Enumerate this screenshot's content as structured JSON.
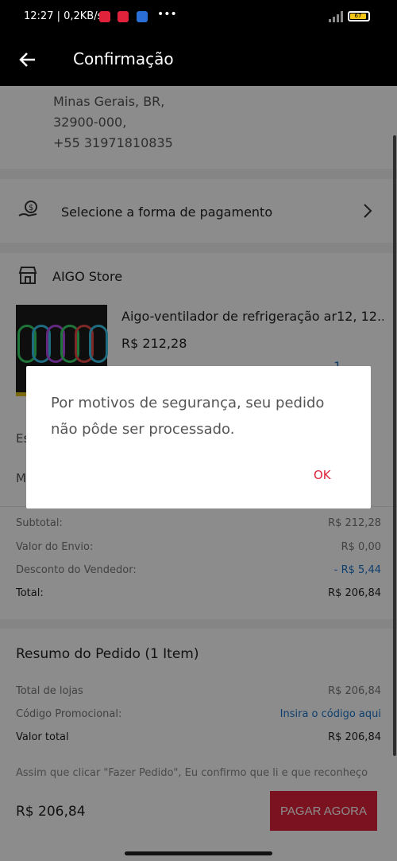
{
  "status": {
    "time": "12:27 | 0,2KB/s",
    "battery": "67",
    "network": "4G"
  },
  "appbar": {
    "title": "Confirmação"
  },
  "address": {
    "lines": [
      "Minas Gerais, BR,",
      "32900-000,",
      "+55 31971810835"
    ]
  },
  "payment": {
    "label": "Selecione a forma de pagamento"
  },
  "store": {
    "name": "AIGO Store"
  },
  "product": {
    "title": "Aigo-ventilador de refrigeração ar12, 12...",
    "price": "R$ 212,28",
    "qty": "1"
  },
  "partial": {
    "shipping_prefix": "Es",
    "message_prefix": "M"
  },
  "totals": {
    "subtotal_label": "Subtotal:",
    "subtotal": "R$ 212,28",
    "shipping_label": "Valor do Envio:",
    "shipping": "R$ 0,00",
    "discount_label": "Desconto do Vendedor:",
    "discount": "- R$ 5,44",
    "total_label": "Total:",
    "total": "R$ 206,84"
  },
  "summary": {
    "title": "Resumo do Pedido (1 Item)",
    "stores_label": "Total de lojas",
    "stores_value": "R$ 206,84",
    "promo_label": "Código Promocional:",
    "promo_link": "Insira o código aqui",
    "total_label": "Valor total",
    "total_value": "R$ 206,84",
    "disclaimer": "Assim que clicar \"Fazer Pedido\", Eu confirmo que li e que reconheço"
  },
  "bottom": {
    "total": "R$ 206,84",
    "button": "PAGAR AGORA"
  },
  "dialog": {
    "message": "Por motivos de segurança, seu pedido não pôde ser processado.",
    "ok": "OK"
  },
  "colors": {
    "accent": "#e0223a",
    "link": "#1a73c8"
  }
}
